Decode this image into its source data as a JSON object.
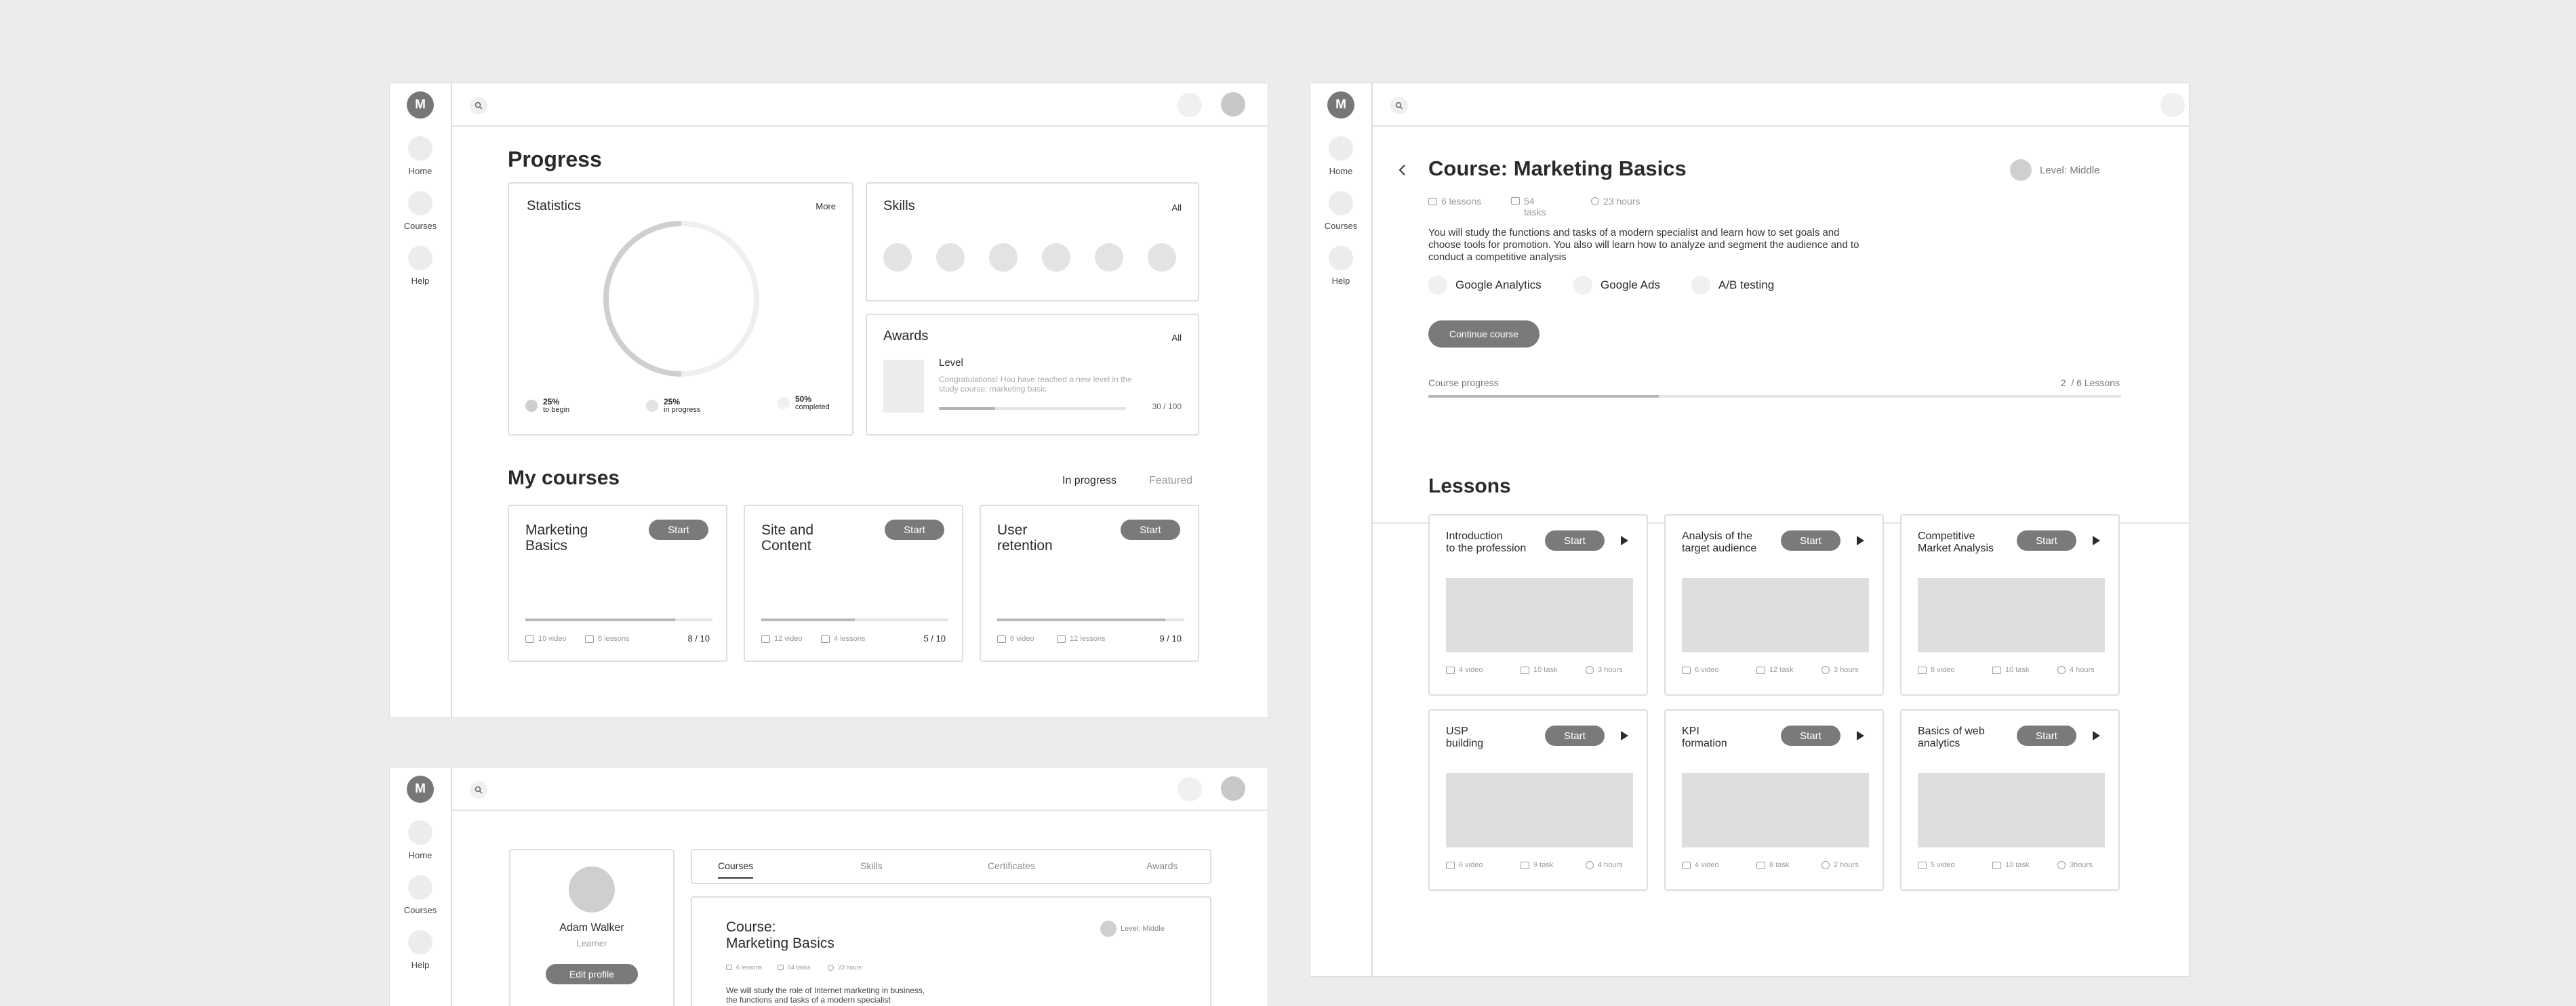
{
  "sidebar": {
    "logo": "M",
    "items": [
      {
        "label": "Home"
      },
      {
        "label": "Courses"
      },
      {
        "label": "Help"
      }
    ]
  },
  "progress_screen": {
    "title": "Progress",
    "statistics": {
      "title": "Statistics",
      "more": "More",
      "completed_fraction": 0.5,
      "legend": [
        {
          "value": "25%",
          "label": "to begin"
        },
        {
          "value": "25%",
          "label": "in progress"
        },
        {
          "value": "50%",
          "label": "completed"
        }
      ]
    },
    "skills": {
      "title": "Skills",
      "all": "All"
    },
    "awards": {
      "title": "Awards",
      "all": "All",
      "level_title": "Level",
      "message": "Congratulations! Hou have reached a new level in the study course: marketing basic",
      "score": "30 / 100",
      "score_fraction": 0.3
    },
    "my_courses": {
      "title": "My courses",
      "tab_in_progress": "In progress",
      "tab_featured": "Featured",
      "courses": [
        {
          "title_line1": "Marketing",
          "title_line2": "Basics",
          "start": "Start",
          "videos": "10 video",
          "lessons": "6 lessons",
          "progress": "8 / 10",
          "progress_fraction": 0.8
        },
        {
          "title_line1": "Site and",
          "title_line2": "Content",
          "start": "Start",
          "videos": "12 video",
          "lessons": "4 lessons",
          "progress": "5 / 10",
          "progress_fraction": 0.5
        },
        {
          "title_line1": "User",
          "title_line2": "retention",
          "start": "Start",
          "videos": "6 video",
          "lessons": "12 lessons",
          "progress": "9 / 10",
          "progress_fraction": 0.9
        }
      ]
    }
  },
  "course_screen": {
    "title": "Course: Marketing Basics",
    "level": "Level: Middle",
    "stats": {
      "lessons": "6 lessons",
      "tasks_line1": "54",
      "tasks_line2": "tasks",
      "hours": "23 hours"
    },
    "description": "You will study the functions and tasks of a modern specialist and learn how to set goals and choose tools for promotion. You also will learn how to analyze and segment the audience and to conduct a competitive analysis",
    "tools": [
      "Google Analytics",
      "Google Ads",
      "A/B testing"
    ],
    "continue_button": "Continue course",
    "course_progress_label": "Course progress",
    "course_progress_value": "2  / 6 Lessons",
    "course_progress_fraction": 0.333,
    "lessons_title": "Lessons",
    "lessons": [
      {
        "title_line1": "Introduction",
        "title_line2": "to the profession",
        "start": "Start",
        "videos": "4 video",
        "tasks": "10 task",
        "hours": "3 hours"
      },
      {
        "title_line1": "Analysis of the",
        "title_line2": "target audience",
        "start": "Start",
        "videos": "6 video",
        "tasks": "12 task",
        "hours": "3 hours"
      },
      {
        "title_line1": "Competitive",
        "title_line2": "Market Analysis",
        "start": "Start",
        "videos": "8 video",
        "tasks": "10 task",
        "hours": "4 hours"
      },
      {
        "title_line1": "USP",
        "title_line2": "building",
        "start": "Start",
        "videos": "6 video",
        "tasks": "9 task",
        "hours": "4 hours"
      },
      {
        "title_line1": "KPI",
        "title_line2": "formation",
        "start": "Start",
        "videos": "4 video",
        "tasks": "8 task",
        "hours": "2 hours"
      },
      {
        "title_line1": "Basics of web",
        "title_line2": "analytics",
        "start": "Start",
        "videos": "5 video",
        "tasks": "10 task",
        "hours": "3hours"
      }
    ]
  },
  "profile_screen": {
    "name": "Adam Walker",
    "role": "Learner",
    "edit_button": "Edit profile",
    "tabs": [
      "Courses",
      "Skills",
      "Certificates",
      "Awards"
    ],
    "course_title_line1": "Course:",
    "course_title_line2": "Marketing Basics",
    "level": "Level: Middle",
    "stats": {
      "lessons": "6 lessons",
      "tasks": "54 tasks",
      "hours": "23 hours"
    },
    "description_line1": "We will study the role of Internet marketing in business,",
    "description_line2": "the functions and tasks of a modern specialist"
  }
}
